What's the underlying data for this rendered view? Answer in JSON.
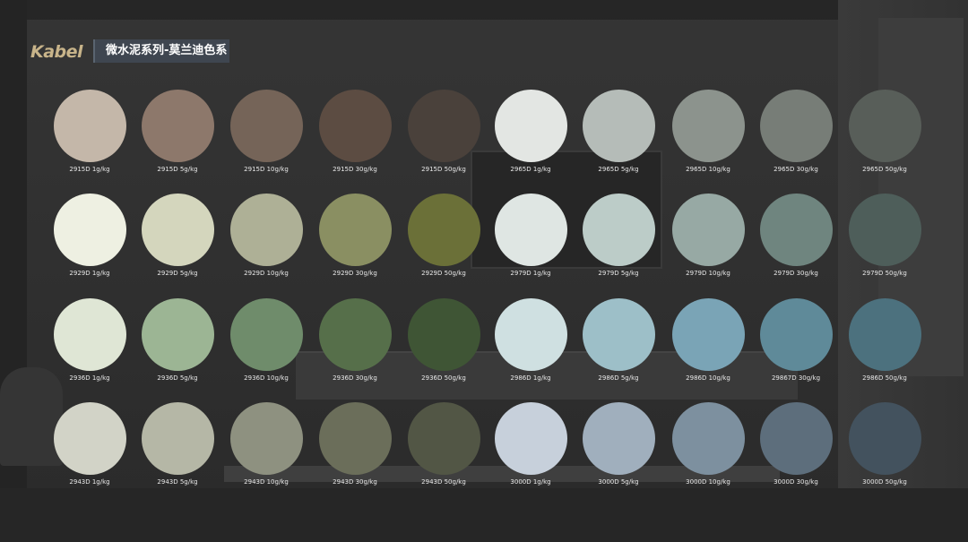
{
  "header": {
    "logo_text": "Kabel",
    "title": "微水泥系列-莫兰迪色系"
  },
  "swatches": [
    [
      {
        "label": "2915D 1g/kg",
        "color": "#c4b7a9"
      },
      {
        "label": "2915D 5g/kg",
        "color": "#8d786b"
      },
      {
        "label": "2915D 10g/kg",
        "color": "#756458"
      },
      {
        "label": "2915D 30g/kg",
        "color": "#5c4c42"
      },
      {
        "label": "2915D 50g/kg",
        "color": "#4a413b"
      },
      {
        "label": "2965D 1g/kg",
        "color": "#e3e6e3"
      },
      {
        "label": "2965D 5g/kg",
        "color": "#b5bcb8"
      },
      {
        "label": "2965D 10g/kg",
        "color": "#8c938d"
      },
      {
        "label": "2965D 30g/kg",
        "color": "#777d77"
      },
      {
        "label": "2965D 50g/kg",
        "color": "#585e59"
      }
    ],
    [
      {
        "label": "2929D 1g/kg",
        "color": "#eef0e2"
      },
      {
        "label": "2929D 5g/kg",
        "color": "#d4d6bd"
      },
      {
        "label": "2929D 10g/kg",
        "color": "#aeb096"
      },
      {
        "label": "2929D 30g/kg",
        "color": "#8a8f62"
      },
      {
        "label": "2929D 50g/kg",
        "color": "#6b7038"
      },
      {
        "label": "2979D 1g/kg",
        "color": "#dfe6e3"
      },
      {
        "label": "2979D 5g/kg",
        "color": "#bcccc8"
      },
      {
        "label": "2979D 10g/kg",
        "color": "#97a9a4"
      },
      {
        "label": "2979D 30g/kg",
        "color": "#6f857f"
      },
      {
        "label": "2979D 50g/kg",
        "color": "#4e5e5a"
      }
    ],
    [
      {
        "label": "2936D 1g/kg",
        "color": "#dfe6d5"
      },
      {
        "label": "2936D 5g/kg",
        "color": "#9cb594"
      },
      {
        "label": "2936D 10g/kg",
        "color": "#6f8c6b"
      },
      {
        "label": "2936D 30g/kg",
        "color": "#566f4a"
      },
      {
        "label": "2936D 50g/kg",
        "color": "#3f5535"
      },
      {
        "label": "2986D 1g/kg",
        "color": "#cfe0e1"
      },
      {
        "label": "2986D 5g/kg",
        "color": "#9dbfc8"
      },
      {
        "label": "2986D 10g/kg",
        "color": "#7aa4b6"
      },
      {
        "label": "29867D 30g/kg",
        "color": "#5f8a99"
      },
      {
        "label": "2986D 50g/kg",
        "color": "#4c717e"
      }
    ],
    [
      {
        "label": "2943D 1g/kg",
        "color": "#d2d3c7"
      },
      {
        "label": "2943D 5g/kg",
        "color": "#b5b7a6"
      },
      {
        "label": "2943D 10g/kg",
        "color": "#8e9180"
      },
      {
        "label": "2943D 30g/kg",
        "color": "#6b6e5a"
      },
      {
        "label": "2943D 50g/kg",
        "color": "#525645"
      },
      {
        "label": "3000D 1g/kg",
        "color": "#c7d0db"
      },
      {
        "label": "3000D 5g/kg",
        "color": "#a0afbd"
      },
      {
        "label": "3000D 10g/kg",
        "color": "#7d909f"
      },
      {
        "label": "3000D 30g/kg",
        "color": "#5d6e7c"
      },
      {
        "label": "3000D 50g/kg",
        "color": "#43525e"
      }
    ]
  ]
}
